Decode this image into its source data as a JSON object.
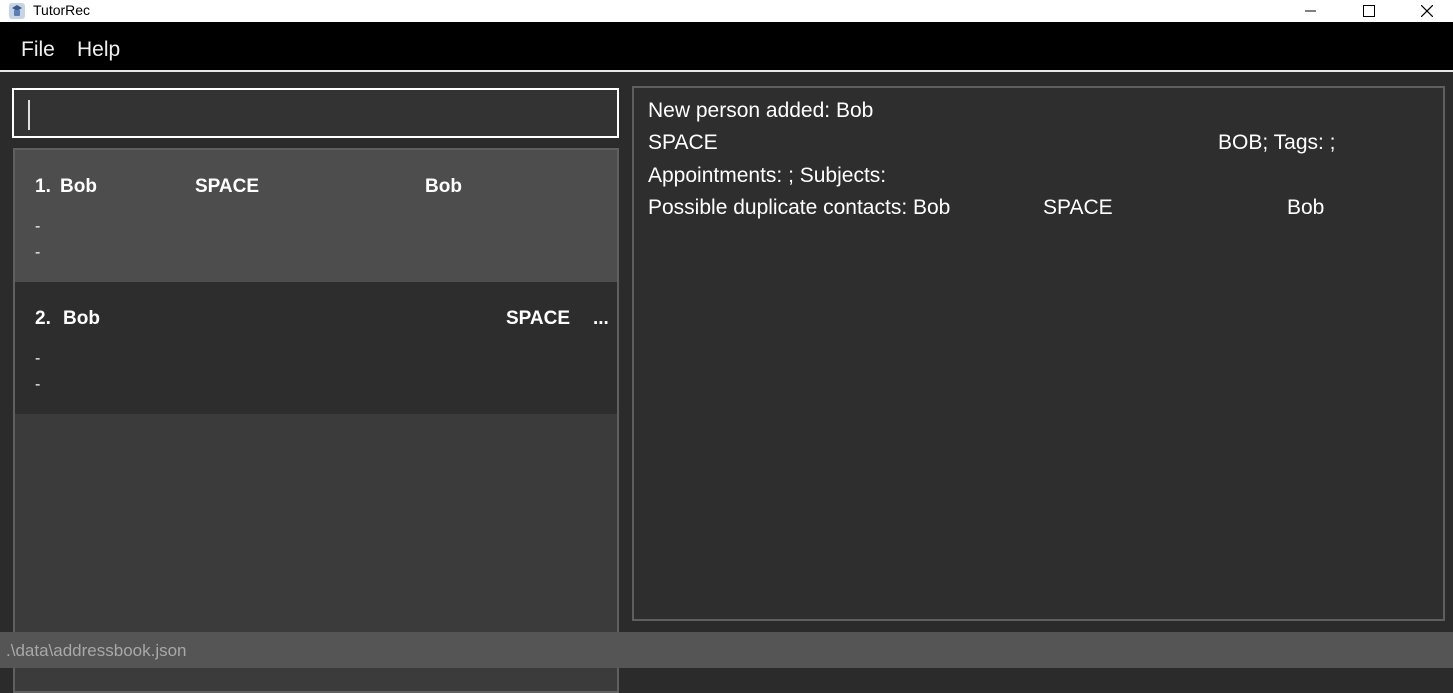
{
  "window": {
    "title": "TutorRec",
    "icon": "app-logo-icon",
    "controls": [
      "minimize-icon",
      "maximize-icon",
      "close-icon"
    ]
  },
  "menu": {
    "file": "File",
    "help": "Help"
  },
  "command_box": {
    "value": ""
  },
  "person_list": {
    "items": [
      {
        "index": "1.",
        "name": "Bob",
        "field2": "SPACE",
        "field3": "Bob",
        "line1": "-",
        "line2": "-"
      },
      {
        "index": "2.",
        "name": "Bob",
        "field2": "SPACE",
        "field3": "...",
        "line1": "-",
        "line2": "-"
      }
    ]
  },
  "result": {
    "line1": "New person added: Bob",
    "line2_a": "SPACE",
    "line2_b": "BOB; Tags: ;",
    "line3": "Appointments: ; Subjects:",
    "line4_a": "Possible duplicate contacts: Bob",
    "line4_b": "SPACE",
    "line4_c": "Bob"
  },
  "status": {
    "path": ".\\data\\addressbook.json"
  },
  "colors": {
    "background": "#2b2b2b",
    "menubar": "#000000",
    "selected_card": "#4d4d4d",
    "card": "#2d2d2d",
    "statusbar": "#555555"
  }
}
